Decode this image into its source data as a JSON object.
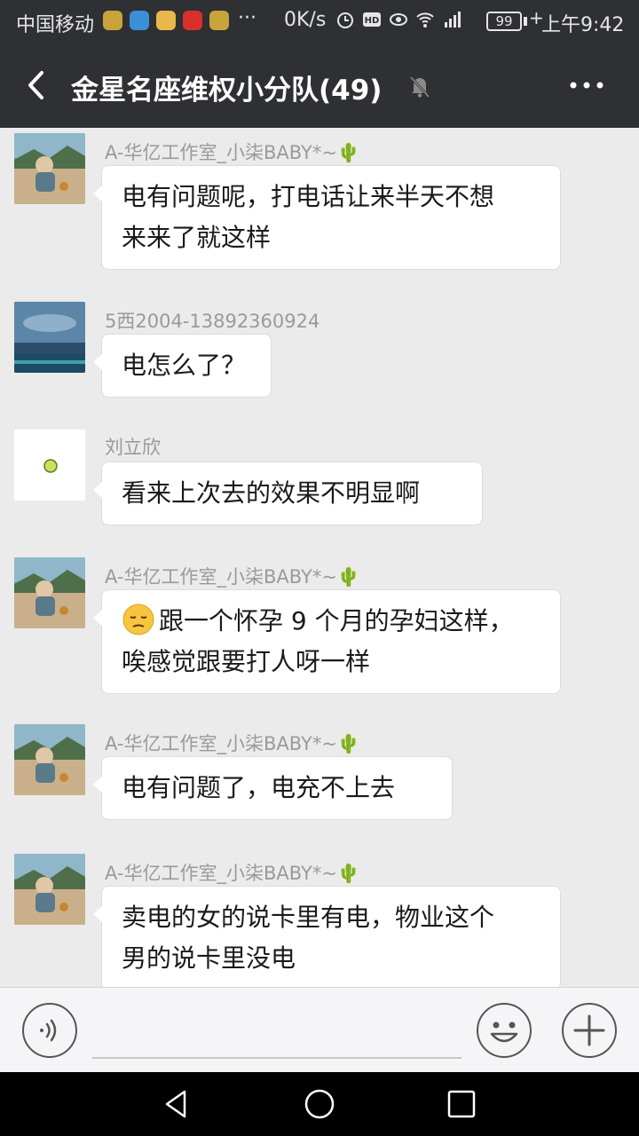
{
  "status_bar": {
    "carrier": "中国移动",
    "more_indicator": "···",
    "net_speed": "0K/s",
    "battery": "99",
    "charging": "+",
    "time": "上午9:42",
    "icons": [
      "app-icon-1",
      "app-icon-2",
      "weibo-icon",
      "app-icon-4",
      "tiktok-icon",
      "alarm-icon",
      "hd-icon",
      "eye-icon",
      "wifi-icon",
      "signal-icon"
    ]
  },
  "header": {
    "title": "金星名座维权小分队(49)",
    "back_icon": "chevron-left-icon",
    "mute_icon": "bell-muted-icon",
    "more_icon": "more-dots-icon"
  },
  "messages": [
    {
      "sender": "A-华亿工作室_小柒BABY*~🌵",
      "lines": [
        "电有问题呢，打电话让来半天不想",
        "来来了就这样"
      ],
      "avatar": "photo-child-lake"
    },
    {
      "sender": "5西2004-13892360924",
      "lines": [
        "电怎么了？"
      ],
      "avatar": "photo-lake-sky"
    },
    {
      "sender": "刘立欣",
      "lines": [
        "看来上次去的效果不明显啊"
      ],
      "avatar": "white-dot"
    },
    {
      "sender": "A-华亿工作室_小柒BABY*~🌵",
      "emoji": "pensive-face-emoji",
      "lines": [
        "跟一个怀孕 9 个月的孕妇这样，",
        "唉感觉跟要打人呀一样"
      ],
      "avatar": "photo-child-lake"
    },
    {
      "sender": "A-华亿工作室_小柒BABY*~🌵",
      "lines": [
        "电有问题了，电充不上去"
      ],
      "avatar": "photo-child-lake"
    },
    {
      "sender": "A-华亿工作室_小柒BABY*~🌵",
      "lines": [
        "卖电的女的说卡里有电，物业这个",
        "男的说卡里没电"
      ],
      "avatar": "photo-child-lake"
    }
  ],
  "input_bar": {
    "voice_icon": "voice-icon",
    "emoji_icon": "emoji-icon",
    "plus_icon": "plus-icon"
  },
  "nav_bar": {
    "icons": [
      "nav-back-icon",
      "nav-home-icon",
      "nav-recent-icon"
    ]
  },
  "colors": {
    "header_bg": "#2f3033",
    "chat_bg": "#ebebeb",
    "bubble_bg": "#ffffff",
    "sender_text": "#9a9a9a"
  }
}
